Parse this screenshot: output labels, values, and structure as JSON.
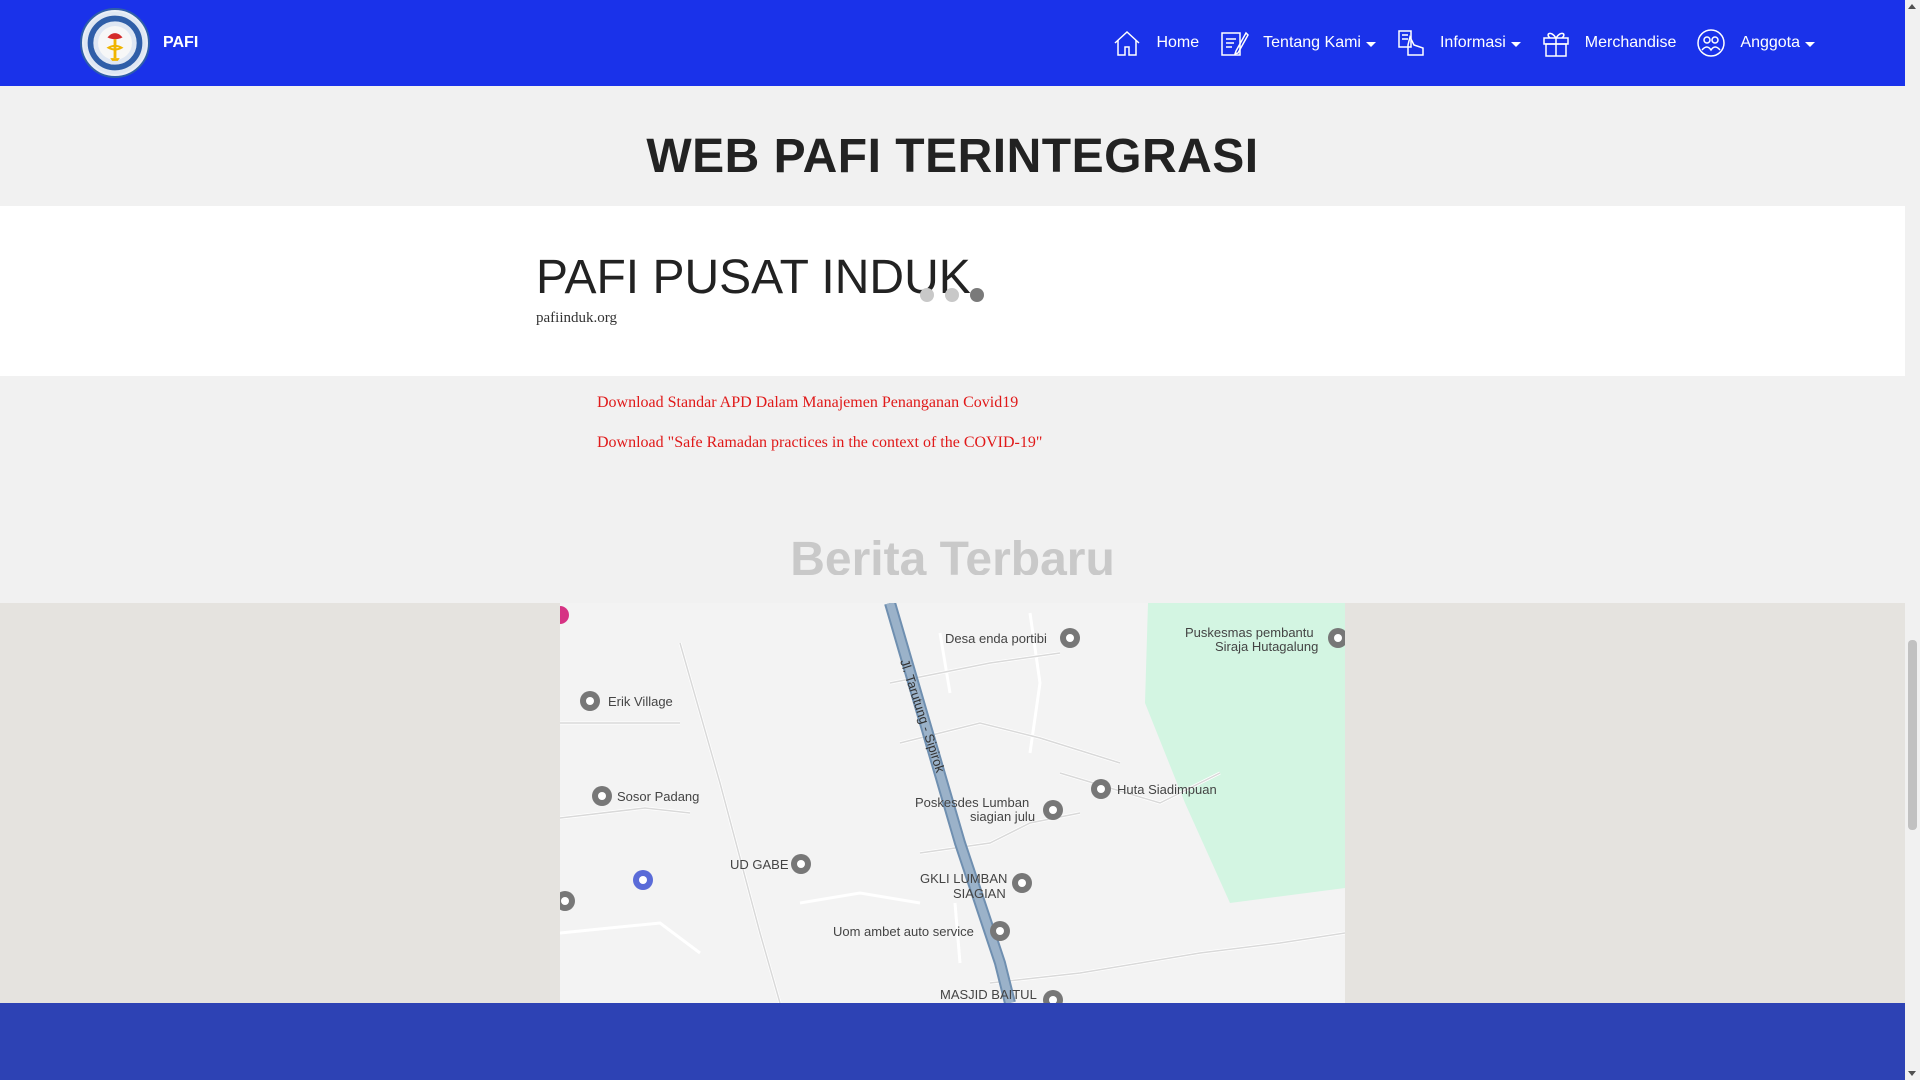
{
  "navbar": {
    "brand": "PAFI",
    "bg_color": "#1a32ea",
    "items": [
      {
        "label": "Home",
        "icon": "home-icon",
        "dropdown": false
      },
      {
        "label": "Tentang Kami",
        "icon": "edit-document-icon",
        "dropdown": true
      },
      {
        "label": "Informasi",
        "icon": "pointer-info-icon",
        "dropdown": true
      },
      {
        "label": "Merchandise",
        "icon": "gift-icon",
        "dropdown": false
      },
      {
        "label": "Anggota",
        "icon": "members-icon",
        "dropdown": true
      }
    ]
  },
  "hero": {
    "title": "WEB PAFI TERINTEGRASI"
  },
  "slider": {
    "title": "PAFI PUSAT INDUK",
    "subtitle": "pafiinduk.org",
    "slide_count": 3,
    "active_index": 2
  },
  "downloads": {
    "link_color": "#e01919",
    "links": [
      "Download Standar APD Dalam Manajemen Penanganan Covid19",
      "Download \"Safe Ramadan practices in the context of the COVID-19\""
    ]
  },
  "news": {
    "heading": "Berita Terbaru"
  },
  "map": {
    "labels": {
      "desa": "Desa enda portibi",
      "puskesmas_1": "Puskesmas pembantu",
      "puskesmas_2": "Siraja Hutagalung",
      "erik": "Erik Village",
      "road": "Jl. Tarutung - Sipirok",
      "sosor": "Sosor Padang",
      "huta": "Huta Siadimpuan",
      "poskesdes_1": "Poskesdes Lumban",
      "poskesdes_2": "siagian julu",
      "udgabe": "UD GABE",
      "gkli_1": "GKLI LUMBAN",
      "gkli_2": "SIAGIAN",
      "uom": "Uom ambet auto service",
      "masjid": "MASJID BAITUL"
    }
  },
  "footer": {
    "bg_color": "#2d42b4"
  }
}
